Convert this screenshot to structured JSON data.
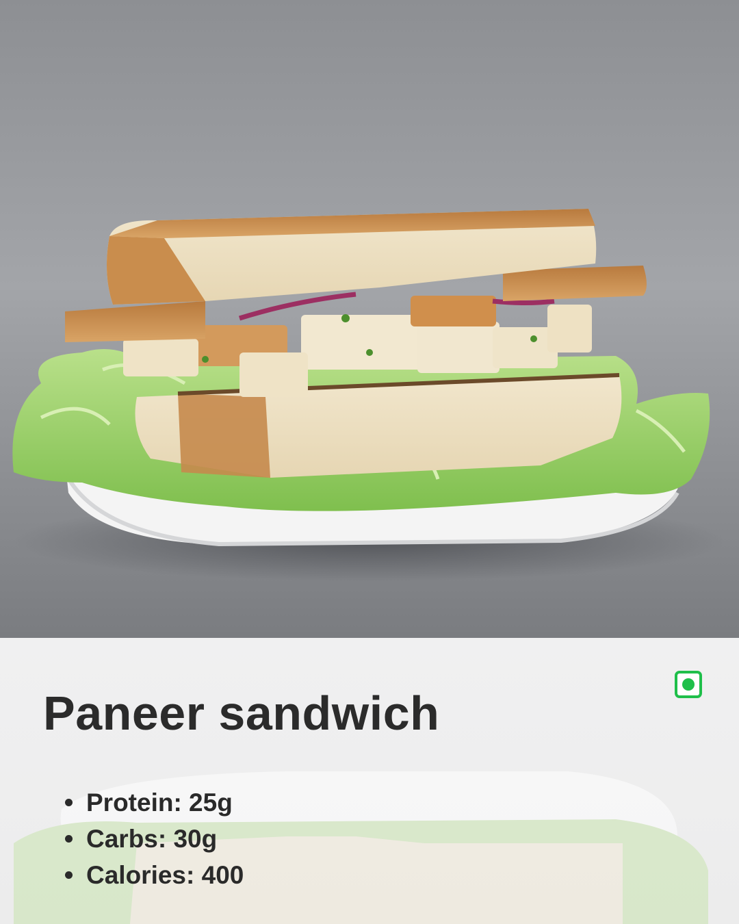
{
  "dish": {
    "title": "Paneer sandwich",
    "photo_icon": "sandwich-photo",
    "veg_icon": "veg-indicator-icon",
    "veg_color": "#1fbf4a"
  },
  "nutrition": [
    {
      "label": "Protein: 25g"
    },
    {
      "label": "Carbs: 30g"
    },
    {
      "label": "Calories: 400"
    }
  ],
  "colors": {
    "backdrop": "#8f9196",
    "panel": "#efefef",
    "text": "#2b2b2b"
  }
}
